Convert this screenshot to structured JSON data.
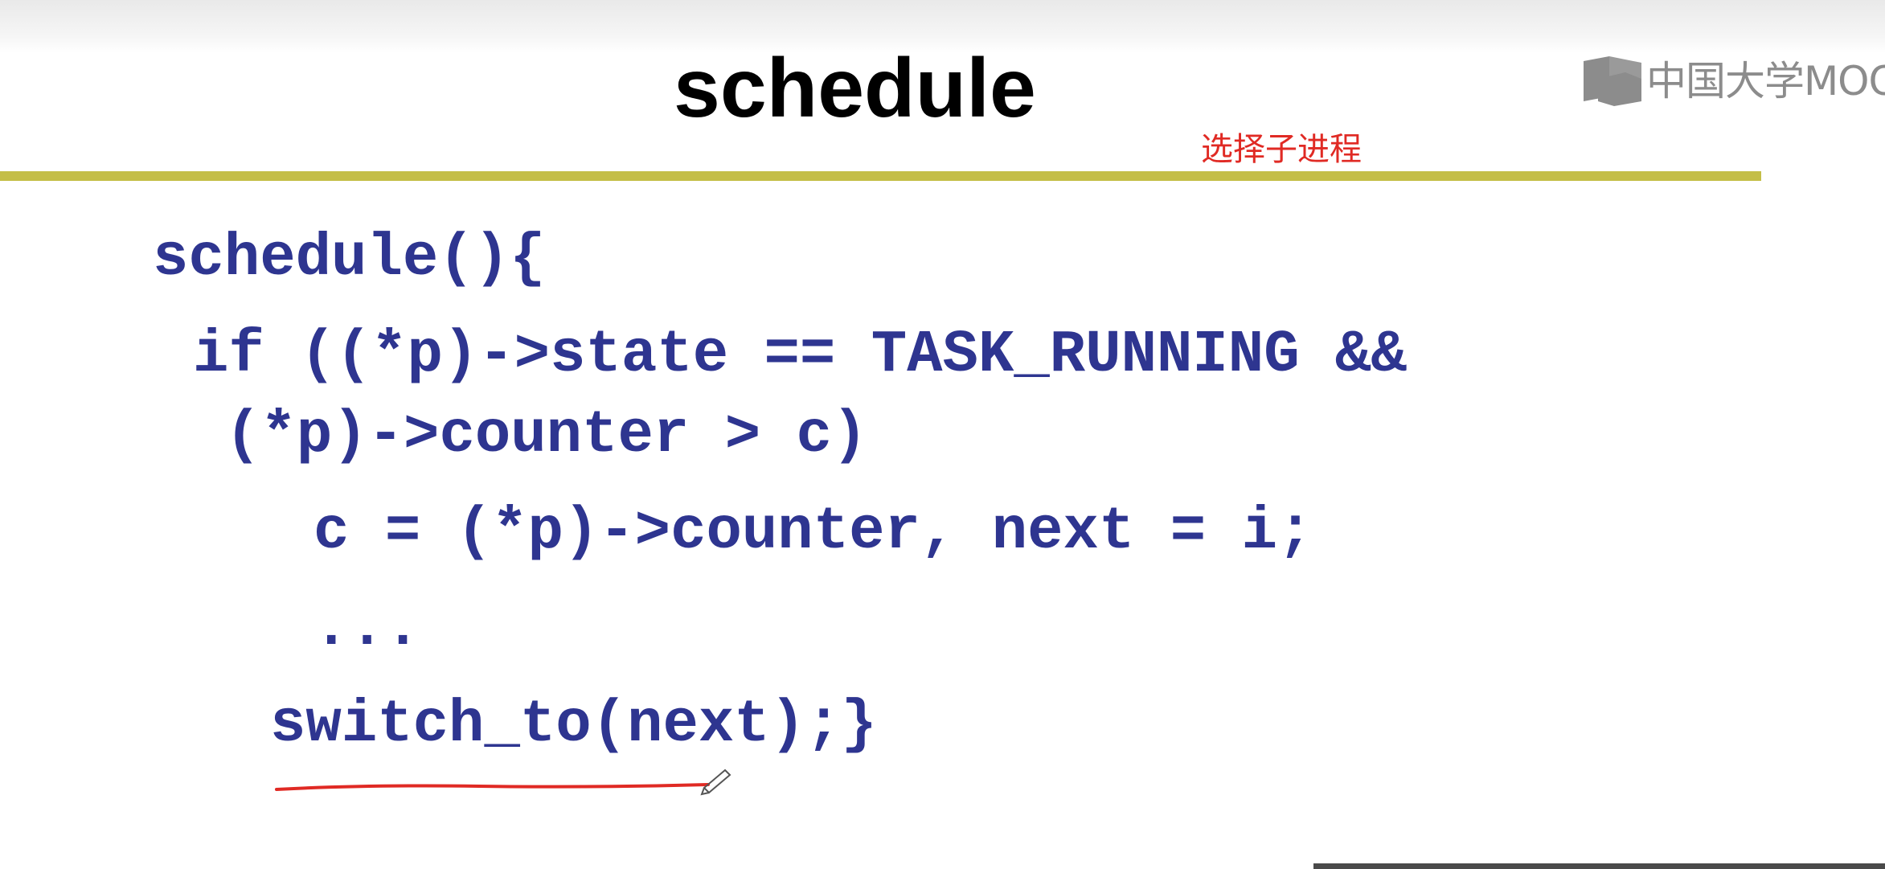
{
  "slide": {
    "title": "schedule",
    "annotation": "选择子进程",
    "logo_text": "中国大学MOOC",
    "logo_icon": "book-icon",
    "colors": {
      "code": "#2e3590",
      "rule": "#c4be47",
      "annotation": "#e02a24",
      "underline": "#e02a24"
    }
  },
  "code": {
    "line1": "schedule(){",
    "line2": "if ((*p)->state == TASK_RUNNING &&",
    "line3": "(*p)->counter > c)",
    "line4": "c = (*p)->counter, next = i;",
    "line5": "...",
    "line6": "switch_to(next);}"
  }
}
